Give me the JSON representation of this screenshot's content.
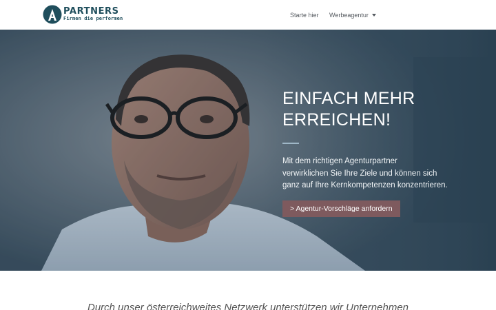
{
  "header": {
    "logo_name": "PARTNERS",
    "logo_tagline": "Firmen die performen",
    "nav": [
      {
        "label": "Starte hier"
      },
      {
        "label": "Werbeagentur"
      }
    ]
  },
  "hero": {
    "title_line1": "EINFACH MEHR",
    "title_line2": "ERREICHEN!",
    "text_line1": "Mit dem richtigen Agenturpartner",
    "text_line2": "verwirklichen Sie Ihre Ziele und können sich",
    "text_line3": "ganz auf Ihre Kernkompetenzen konzentrieren.",
    "cta_label": "> Agentur-Vorschläge anfordern"
  },
  "below": {
    "intro_text": "Durch unser österreichweites Netzwerk unterstützen wir Unternehmen"
  },
  "colors": {
    "brand": "#1f4e5c",
    "cta": "#7e5a5e",
    "divider": "#9fb7c7"
  }
}
